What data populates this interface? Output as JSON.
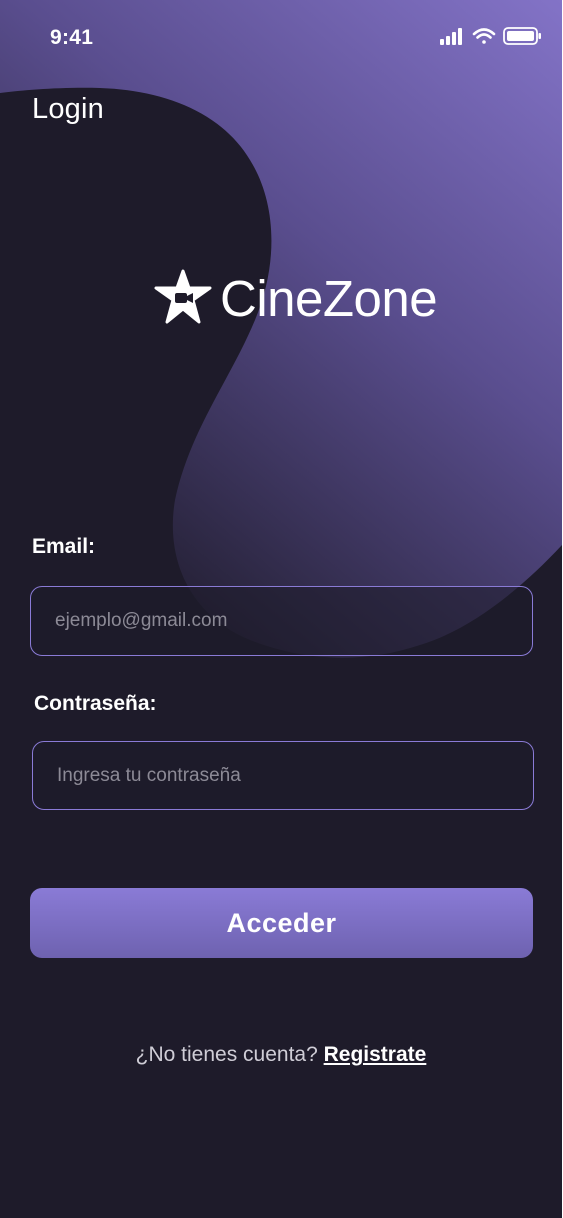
{
  "status_bar": {
    "time": "9:41",
    "icons": [
      "cellular-signal-icon",
      "wifi-icon",
      "battery-icon"
    ]
  },
  "header": {
    "title": "Login"
  },
  "logo": {
    "icon": "star-camera-icon",
    "text": "CineZone"
  },
  "form": {
    "email_label": "Email:",
    "email_placeholder": "ejemplo@gmail.com",
    "email_value": "",
    "password_label": "Contraseña:",
    "password_placeholder": "Ingresa tu contraseña",
    "password_value": "",
    "submit_label": "Acceder"
  },
  "signup": {
    "prompt": "¿No tienes cuenta?",
    "link_label": "Registrate"
  },
  "colors": {
    "background": "#1e1b2a",
    "accent": "#8a7bd6",
    "accent_dark": "#6e62b0",
    "text": "#ffffff",
    "placeholder": "#8c8a96"
  }
}
